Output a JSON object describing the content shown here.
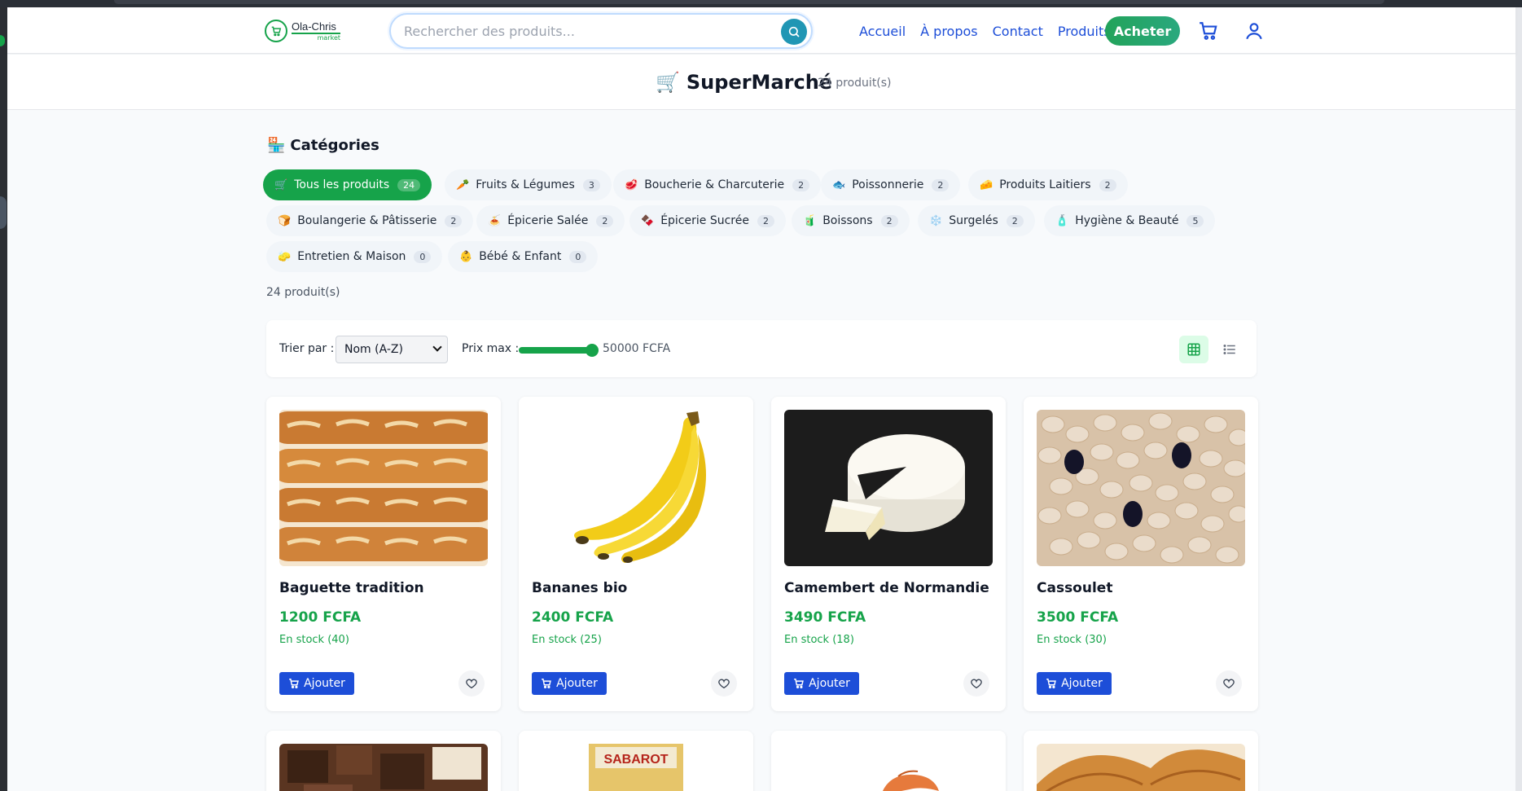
{
  "brand": {
    "name": "Ola-Chris",
    "sub": "market"
  },
  "search": {
    "placeholder": "Rechercher des produits..."
  },
  "nav": {
    "items": [
      "Accueil",
      "À propos",
      "Contact",
      "Produits"
    ],
    "buy_label": "Acheter"
  },
  "page": {
    "title": "SuperMarché",
    "count": "24 produit(s)"
  },
  "categories": {
    "heading": "Catégories",
    "items": [
      {
        "icon": "🛒",
        "label": "Tous les produits",
        "count": "24"
      },
      {
        "icon": "🥕",
        "label": "Fruits & Légumes",
        "count": "3"
      },
      {
        "icon": "🥩",
        "label": "Boucherie & Charcuterie",
        "count": "2"
      },
      {
        "icon": "🐟",
        "label": "Poissonnerie",
        "count": "2"
      },
      {
        "icon": "🧀",
        "label": "Produits Laitiers",
        "count": "2"
      },
      {
        "icon": "🍞",
        "label": "Boulangerie & Pâtisserie",
        "count": "2"
      },
      {
        "icon": "🍝",
        "label": "Épicerie Salée",
        "count": "2"
      },
      {
        "icon": "🍫",
        "label": "Épicerie Sucrée",
        "count": "2"
      },
      {
        "icon": "🧃",
        "label": "Boissons",
        "count": "2"
      },
      {
        "icon": "❄️",
        "label": "Surgelés",
        "count": "2"
      },
      {
        "icon": "🧴",
        "label": "Hygiène & Beauté",
        "count": "5"
      },
      {
        "icon": "🧽",
        "label": "Entretien & Maison",
        "count": "0"
      },
      {
        "icon": "👶",
        "label": "Bébé & Enfant",
        "count": "0"
      }
    ]
  },
  "results": {
    "count": "24 produit(s)"
  },
  "filters": {
    "sort_label": "Trier par :",
    "sort_value": "Nom (A-Z)",
    "price_label": "Prix max :",
    "price_value": "50000 FCFA",
    "price_fraction": 1.0
  },
  "products": [
    {
      "name": "Baguette tradition",
      "price": "1200 FCFA",
      "stock": "En stock (40)",
      "add": "Ajouter"
    },
    {
      "name": "Bananes bio",
      "price": "2400 FCFA",
      "stock": "En stock (25)",
      "add": "Ajouter"
    },
    {
      "name": "Camembert de Normandie",
      "price": "3490 FCFA",
      "stock": "En stock (18)",
      "add": "Ajouter"
    },
    {
      "name": "Cassoulet",
      "price": "3500 FCFA",
      "stock": "En stock (30)",
      "add": "Ajouter"
    }
  ],
  "colors": {
    "accent": "#16a34a",
    "primary": "#1d4ed8",
    "link": "#1d4ed8"
  }
}
